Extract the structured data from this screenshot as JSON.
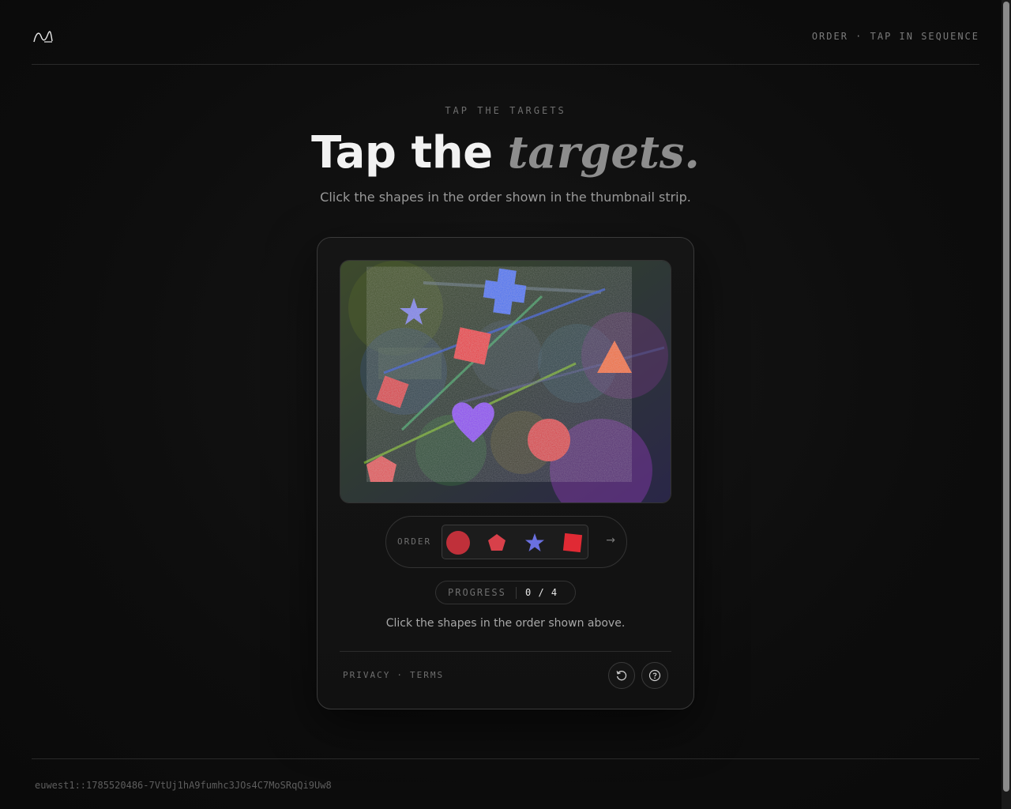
{
  "header": {
    "logo_icon": "wave-logo-icon",
    "nav_text": "ORDER · TAP IN SEQUENCE"
  },
  "hero": {
    "eyebrow": "TAP THE TARGETS",
    "title_plain": "Tap the ",
    "title_emphasis": "targets.",
    "subtitle": "Click the shapes in the order shown in the thumbnail strip."
  },
  "challenge": {
    "canvas_shapes": [
      {
        "shape": "cross",
        "color": "#3f6ef0"
      },
      {
        "shape": "star",
        "color": "#7b7fe8"
      },
      {
        "shape": "square",
        "color": "#e82a34"
      },
      {
        "shape": "triangle",
        "color": "#f06a2a"
      },
      {
        "shape": "square",
        "color": "#d8303a"
      },
      {
        "shape": "heart",
        "color": "#8a3cf0"
      },
      {
        "shape": "circle",
        "color": "#d8343c"
      },
      {
        "shape": "pentagon",
        "color": "#e04a4e"
      }
    ],
    "order_label": "ORDER",
    "order_sequence": [
      {
        "shape": "circle",
        "color": "#c0303a"
      },
      {
        "shape": "pentagon",
        "color": "#d8404a"
      },
      {
        "shape": "star",
        "color": "#6a70e0"
      },
      {
        "shape": "square",
        "color": "#e02a34"
      }
    ],
    "order_arrow": "→",
    "progress_label": "PROGRESS",
    "progress_value": "0 / 4",
    "instruction": "Click the shapes in the order shown above."
  },
  "card_footer": {
    "privacy": "PRIVACY",
    "separator": "·",
    "terms": "TERMS",
    "refresh_icon": "refresh-icon",
    "help_icon": "help-icon"
  },
  "footer": {
    "session_id": "euwest1::1785520486-7VtUj1hA9fumhc3JOs4C7MoSRqQi9Uw8"
  }
}
